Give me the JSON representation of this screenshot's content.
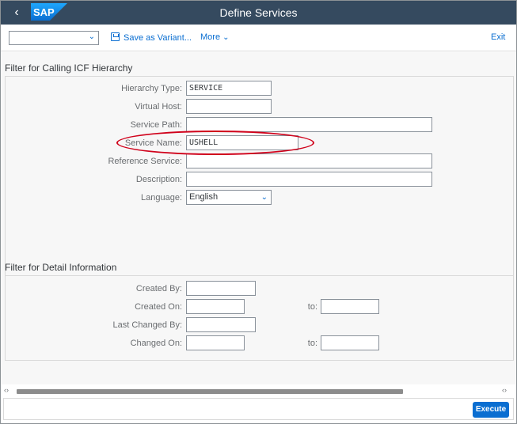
{
  "shell": {
    "title": "Define Services",
    "logo_text": "SAP",
    "back_icon": "chevron-left-icon"
  },
  "toolbar": {
    "variant_value": "",
    "save_as_variant": "Save as Variant...",
    "more": "More",
    "exit": "Exit"
  },
  "icf_section": {
    "title": "Filter for Calling ICF Hierarchy",
    "fields": {
      "hierarchy_type": {
        "label": "Hierarchy Type:",
        "value": "SERVICE"
      },
      "virtual_host": {
        "label": "Virtual Host:",
        "value": ""
      },
      "service_path": {
        "label": "Service Path:",
        "value": ""
      },
      "service_name": {
        "label": "Service Name:",
        "value": "USHELL"
      },
      "reference_service": {
        "label": "Reference Service:",
        "value": ""
      },
      "description": {
        "label": "Description:",
        "value": ""
      },
      "language": {
        "label": "Language:",
        "value": "English"
      }
    }
  },
  "detail_section": {
    "title": "Filter for Detail Information",
    "fields": {
      "created_by": {
        "label": "Created By:",
        "value": ""
      },
      "created_on": {
        "label": "Created On:",
        "value": "",
        "to_label": "to:",
        "to_value": ""
      },
      "last_changed_by": {
        "label": "Last Changed By:",
        "value": ""
      },
      "changed_on": {
        "label": "Changed On:",
        "value": "",
        "to_label": "to:",
        "to_value": ""
      }
    }
  },
  "footer": {
    "execute": "Execute"
  },
  "colors": {
    "shell_bar": "#354a5f",
    "accent": "#0a6ed1",
    "annotation": "#d0021b"
  }
}
